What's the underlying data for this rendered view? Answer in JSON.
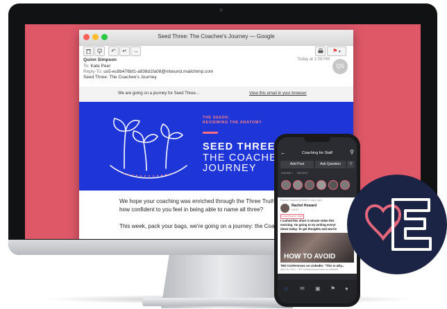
{
  "email_window": {
    "title": "Seed Three: The Coachee's Journey — Google",
    "avatar_initials": "QS",
    "from_name": "Quinn Simpson",
    "to_label": "To:",
    "to_value": "Kate Peer",
    "reply_to_label": "Reply-To:",
    "reply_to_value": "us5-ec8b476bf1-a938d1fa08@inbound.mailchimp.com",
    "subject": "Seed Three: The Coachee's Journey",
    "timestamp": "Today at 1:09 PM",
    "colors": {
      "window_bg": "#ffffff",
      "accent_flag": "#e33b3b"
    }
  },
  "email_body": {
    "preheader_text": "We are going on a journey for Seed Three...",
    "view_in_browser": "View this email in your browser",
    "banner": {
      "eyebrow_line1": "THE SEEDS:",
      "eyebrow_line2": "REVIEWING THE ANATOMY",
      "title_line1": "SEED THREE:",
      "title_line2": "THE COACHEE'",
      "title_line3": "JOURNEY",
      "colors": {
        "bg": "#1e35d8",
        "eyebrow": "#ff7f7f",
        "bar": "#ff6f7d"
      }
    },
    "paragraph1_line1": "We hope your coaching was enriched through the Three Truths last",
    "paragraph1_line2": "how confident to you feel in being able to name all three?",
    "paragraph2": "This week, pack your bags, we're going on a journey: the Coachee's J"
  },
  "phone_app": {
    "nav_title": "Coaching for Staff",
    "add_post_label": "Add Post",
    "ask_question_label": "Ask Question",
    "online_label": "ONLINE •",
    "recent_label": "RECENT",
    "pin_label": "Rachel Howard (Edited 2 days ago)",
    "poster_name": "Rachel Howard",
    "poster_role": "HOST",
    "poster_tag": "Coaching for Staff",
    "post_text_1": "I rushed this short 3 minute video this",
    "post_text_2": "morning. I'm going to try writing everyt",
    "post_text_3": "down today. To get thoughts and worrie",
    "video_overlay": "HOW TO AVOID",
    "link_title": "TED Conferences on LinkedIn: \"This is why...",
    "link_meta": "April 25, 2019 · TED Conferences posted on LinkedIn"
  },
  "colors": {
    "screen_bg": "#de5868",
    "logo_bg": "#1b2444",
    "logo_heart": "#e5677b"
  }
}
